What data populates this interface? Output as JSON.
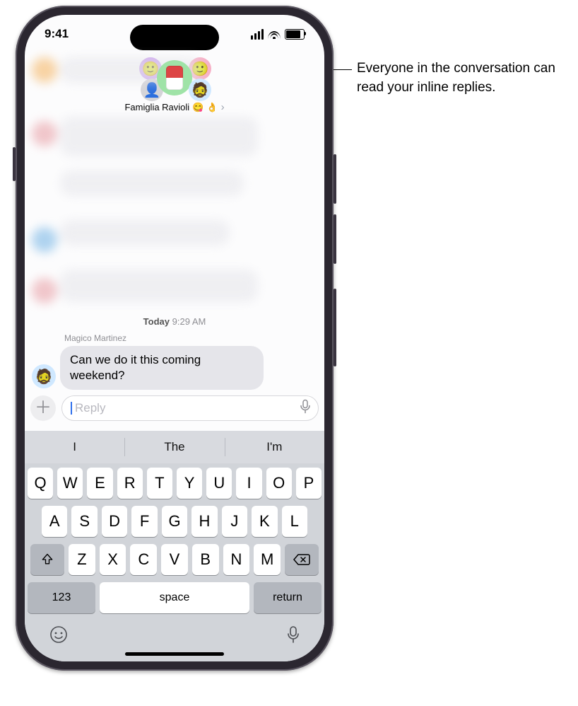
{
  "status": {
    "time": "9:41"
  },
  "header": {
    "group_name": "Famiglia Ravioli",
    "emoji1": "😋",
    "emoji2": "👌"
  },
  "thread": {
    "timestamp_day": "Today",
    "timestamp_time": "9:29 AM",
    "sender": "Magico Martinez",
    "message": "Can we do it this coming weekend?"
  },
  "composer": {
    "placeholder": "Reply"
  },
  "predictive": {
    "s1": "I",
    "s2": "The",
    "s3": "I'm"
  },
  "keyboard": {
    "row1": [
      "Q",
      "W",
      "E",
      "R",
      "T",
      "Y",
      "U",
      "I",
      "O",
      "P"
    ],
    "row2": [
      "A",
      "S",
      "D",
      "F",
      "G",
      "H",
      "J",
      "K",
      "L"
    ],
    "row3": [
      "Z",
      "X",
      "C",
      "V",
      "B",
      "N",
      "M"
    ],
    "num": "123",
    "space": "space",
    "return": "return"
  },
  "callout": "Everyone in the conversation can read your inline replies."
}
